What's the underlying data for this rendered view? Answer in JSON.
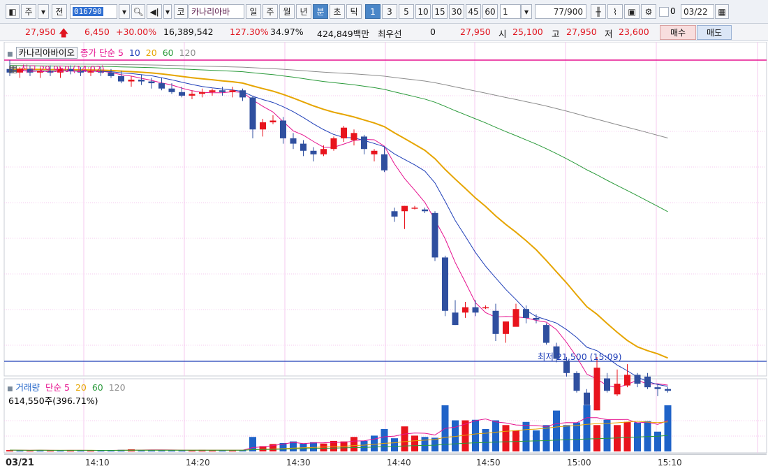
{
  "toolbar": {
    "type_label": "주",
    "period_label": "전",
    "code": "016790",
    "market_label": "코",
    "stock_name": "카나리아바",
    "period_buttons": [
      "일",
      "주",
      "월",
      "년",
      "분",
      "초",
      "틱"
    ],
    "active_period": "분",
    "interval_buttons": [
      "1",
      "3",
      "5",
      "10",
      "15",
      "30",
      "45",
      "60"
    ],
    "active_interval": "1",
    "interval_value": "1",
    "count_text": "77/900",
    "checkbox_label": "0",
    "date_value": "03/22"
  },
  "quote": {
    "price": "27,950",
    "change": "6,450",
    "change_rate": "+30.00%",
    "volume": "16,389,542",
    "volume_ratio": "127.30%",
    "turnover": "34.97%",
    "amount": "424,849백만",
    "priority_label": "최우선",
    "priority_value": "0",
    "current_ask": "27,950",
    "open_label": "시",
    "open": "25,100",
    "high_label": "고",
    "high": "27,950",
    "low_label": "저",
    "low": "23,600",
    "buy_label": "매수",
    "sell_label": "매도"
  },
  "colors": {
    "up": "#e8141d",
    "down": "#2f4f9f",
    "ma5": "#e6128f",
    "ma10": "#1f3fb8",
    "ma20": "#e6a500",
    "ma60": "#2a9a3a",
    "ma120": "#8c8c8c",
    "grid": "#f5c8ef",
    "vol_up": "#e8141d",
    "vol_down": "#1f63c8"
  },
  "price_panel": {
    "title": "카나리아바이오",
    "ma_prefix": "종가 단순",
    "ma_periods": [
      "5",
      "10",
      "20",
      "60",
      "120"
    ],
    "high_annotation": "최고 29,950 (14:02)",
    "low_annotation": "최저 21,500 (15:09)"
  },
  "volume_panel": {
    "title": "거래량",
    "ma_prefix": "단순",
    "ma_periods": [
      "5",
      "20",
      "60",
      "120"
    ],
    "value_text": "614,550주(396.71%)"
  },
  "x_axis": {
    "date_label": "03/21",
    "ticks": [
      "14:10",
      "14:20",
      "14:30",
      "14:40",
      "14:50",
      "15:00",
      "15:10"
    ]
  },
  "chart_data": {
    "type": "candlestick",
    "price_low_reference": 21500,
    "price_high_reference": 29950,
    "candles": [
      {
        "o": 29700,
        "h": 29950,
        "l": 29500,
        "c": 29600
      },
      {
        "o": 29600,
        "h": 29750,
        "l": 29450,
        "c": 29700
      },
      {
        "o": 29700,
        "h": 29800,
        "l": 29500,
        "c": 29600
      },
      {
        "o": 29600,
        "h": 29750,
        "l": 29450,
        "c": 29650
      },
      {
        "o": 29650,
        "h": 29800,
        "l": 29500,
        "c": 29600
      },
      {
        "o": 29600,
        "h": 29750,
        "l": 29450,
        "c": 29700
      },
      {
        "o": 29700,
        "h": 29800,
        "l": 29550,
        "c": 29650
      },
      {
        "o": 29650,
        "h": 29750,
        "l": 29500,
        "c": 29600
      },
      {
        "o": 29600,
        "h": 29750,
        "l": 29500,
        "c": 29650
      },
      {
        "o": 29650,
        "h": 29750,
        "l": 29500,
        "c": 29600
      },
      {
        "o": 29600,
        "h": 29700,
        "l": 29450,
        "c": 29500
      },
      {
        "o": 29500,
        "h": 29650,
        "l": 29300,
        "c": 29350
      },
      {
        "o": 29350,
        "h": 29500,
        "l": 29200,
        "c": 29400
      },
      {
        "o": 29400,
        "h": 29550,
        "l": 29250,
        "c": 29350
      },
      {
        "o": 29350,
        "h": 29450,
        "l": 29150,
        "c": 29300
      },
      {
        "o": 29300,
        "h": 29450,
        "l": 29100,
        "c": 29150
      },
      {
        "o": 29150,
        "h": 29300,
        "l": 29000,
        "c": 29050
      },
      {
        "o": 29050,
        "h": 29200,
        "l": 28900,
        "c": 28950
      },
      {
        "o": 28950,
        "h": 29100,
        "l": 28850,
        "c": 29000
      },
      {
        "o": 29000,
        "h": 29150,
        "l": 28900,
        "c": 29050
      },
      {
        "o": 29050,
        "h": 29150,
        "l": 28950,
        "c": 29100
      },
      {
        "o": 29100,
        "h": 29200,
        "l": 28950,
        "c": 29050
      },
      {
        "o": 29050,
        "h": 29200,
        "l": 28900,
        "c": 29100
      },
      {
        "o": 29100,
        "h": 29150,
        "l": 28800,
        "c": 28900
      },
      {
        "o": 28900,
        "h": 28950,
        "l": 27750,
        "c": 28000
      },
      {
        "o": 28000,
        "h": 28300,
        "l": 27800,
        "c": 28200
      },
      {
        "o": 28200,
        "h": 28400,
        "l": 28150,
        "c": 28250
      },
      {
        "o": 28250,
        "h": 28350,
        "l": 27600,
        "c": 27750
      },
      {
        "o": 27750,
        "h": 27900,
        "l": 27450,
        "c": 27600
      },
      {
        "o": 27600,
        "h": 27700,
        "l": 27250,
        "c": 27400
      },
      {
        "o": 27400,
        "h": 27500,
        "l": 27100,
        "c": 27300
      },
      {
        "o": 27300,
        "h": 27550,
        "l": 27250,
        "c": 27450
      },
      {
        "o": 27450,
        "h": 27800,
        "l": 27400,
        "c": 27750
      },
      {
        "o": 27750,
        "h": 28100,
        "l": 27650,
        "c": 28050
      },
      {
        "o": 27700,
        "h": 28000,
        "l": 27550,
        "c": 27900
      },
      {
        "o": 27800,
        "h": 27850,
        "l": 27300,
        "c": 27450
      },
      {
        "o": 27300,
        "h": 27450,
        "l": 27100,
        "c": 27400
      },
      {
        "o": 27300,
        "h": 27500,
        "l": 26800,
        "c": 26850
      },
      {
        "o": 25700,
        "h": 25800,
        "l": 25400,
        "c": 25550
      },
      {
        "o": 25700,
        "h": 25850,
        "l": 25200,
        "c": 25850
      },
      {
        "o": 25800,
        "h": 25850,
        "l": 25750,
        "c": 25800
      },
      {
        "o": 25750,
        "h": 25800,
        "l": 25650,
        "c": 25700
      },
      {
        "o": 25650,
        "h": 25700,
        "l": 24300,
        "c": 24400
      },
      {
        "o": 24400,
        "h": 24450,
        "l": 22750,
        "c": 22900
      },
      {
        "o": 22850,
        "h": 23200,
        "l": 22500,
        "c": 22500
      },
      {
        "o": 22850,
        "h": 23150,
        "l": 22700,
        "c": 23000
      },
      {
        "o": 23000,
        "h": 23200,
        "l": 22750,
        "c": 22850
      },
      {
        "o": 23000,
        "h": 23050,
        "l": 22950,
        "c": 23000
      },
      {
        "o": 22900,
        "h": 23100,
        "l": 22050,
        "c": 22250
      },
      {
        "o": 22250,
        "h": 22600,
        "l": 22000,
        "c": 22600
      },
      {
        "o": 22450,
        "h": 23100,
        "l": 22550,
        "c": 22950
      },
      {
        "o": 22950,
        "h": 23050,
        "l": 22550,
        "c": 22700
      },
      {
        "o": 22700,
        "h": 22800,
        "l": 22550,
        "c": 22650
      },
      {
        "o": 22500,
        "h": 22550,
        "l": 21950,
        "c": 22000
      },
      {
        "o": 21900,
        "h": 22000,
        "l": 21450,
        "c": 21550
      },
      {
        "o": 21500,
        "h": 21600,
        "l": 21050,
        "c": 21150
      },
      {
        "o": 21150,
        "h": 21200,
        "l": 20600,
        "c": 20650
      },
      {
        "o": 20600,
        "h": 20700,
        "l": 20250,
        "c": 20250
      },
      {
        "o": 20100,
        "h": 21600,
        "l": 20100,
        "c": 21300
      },
      {
        "o": 21000,
        "h": 21150,
        "l": 20600,
        "c": 20650
      },
      {
        "o": 20550,
        "h": 21250,
        "l": 20500,
        "c": 20850
      },
      {
        "o": 20800,
        "h": 21400,
        "l": 20750,
        "c": 21100
      },
      {
        "o": 21100,
        "h": 21150,
        "l": 20750,
        "c": 20850
      },
      {
        "o": 21050,
        "h": 21150,
        "l": 20700,
        "c": 20750
      },
      {
        "o": 20750,
        "h": 20850,
        "l": 20500,
        "c": 20700
      },
      {
        "o": 20700,
        "h": 20750,
        "l": 20600,
        "c": 20650
      }
    ],
    "volumes_k": [
      5,
      4,
      4,
      5,
      3,
      4,
      5,
      4,
      4,
      3,
      4,
      6,
      8,
      5,
      6,
      5,
      4,
      5,
      4,
      6,
      5,
      4,
      5,
      4,
      55,
      20,
      28,
      32,
      38,
      30,
      35,
      30,
      40,
      38,
      55,
      40,
      60,
      85,
      50,
      95,
      60,
      55,
      52,
      175,
      118,
      118,
      120,
      85,
      118,
      100,
      80,
      112,
      80,
      100,
      155,
      100,
      110,
      175,
      100,
      120,
      100,
      112,
      110,
      115,
      75,
      614
    ],
    "volume_up_flags": [
      1,
      0,
      1,
      0,
      1,
      0,
      1,
      0,
      1,
      0,
      0,
      0,
      1,
      0,
      0,
      0,
      0,
      0,
      1,
      1,
      1,
      0,
      1,
      0,
      0,
      1,
      1,
      0,
      0,
      0,
      0,
      1,
      1,
      1,
      1,
      0,
      0,
      0,
      0,
      1,
      1,
      0,
      0,
      0,
      0,
      1,
      0,
      0,
      0,
      1,
      1,
      0,
      0,
      0,
      0,
      0,
      0,
      0,
      1,
      0,
      1,
      1,
      0,
      0,
      0,
      0
    ]
  }
}
